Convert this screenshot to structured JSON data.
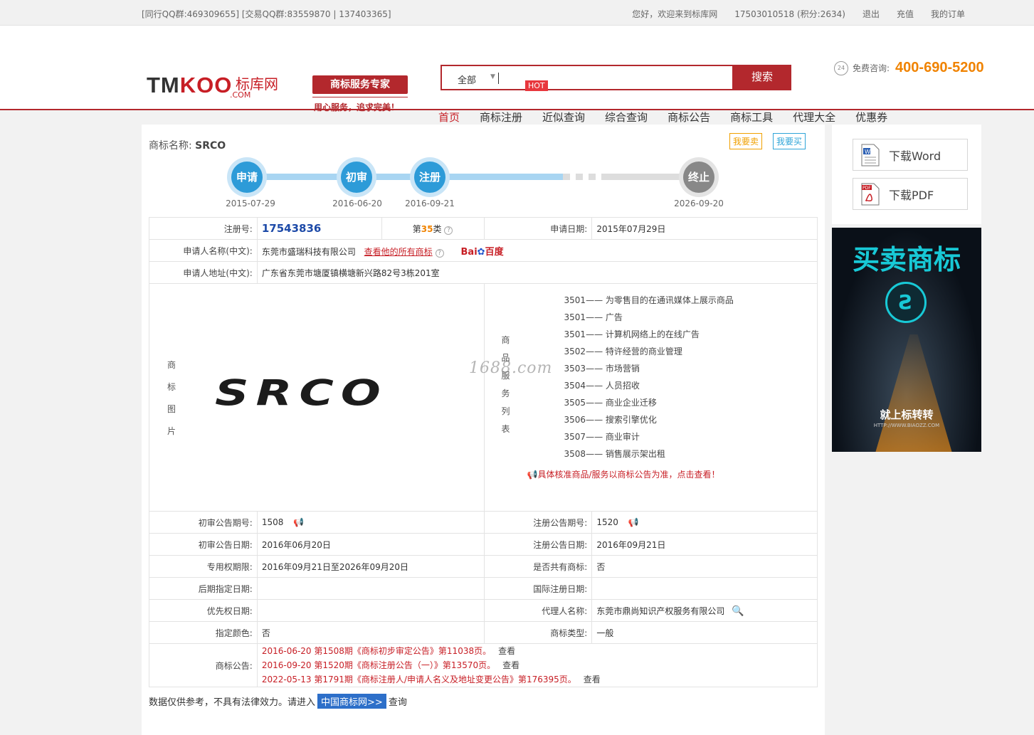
{
  "topbar": {
    "left": "[同行QQ群:469309655] [交易QQ群:83559870 | 137403365]",
    "welcome": "您好，欢迎来到标库网",
    "user": "17503010518 (积分:2634)",
    "logout": "退出",
    "recharge": "充值",
    "orders": "我的订单"
  },
  "logo": {
    "tm": "TM",
    "koo": "KOO",
    "cn": "标库网",
    "com": ".COM"
  },
  "slogan": {
    "title": "商标服务专家",
    "sub": "用心服务，追求完美！"
  },
  "search": {
    "scope": "全部",
    "arrow": "▼",
    "hot": "HOT",
    "button": "搜索",
    "value": ""
  },
  "hotline": {
    "icon_text": "24",
    "label": "免费咨询:",
    "number": "400-690-5200"
  },
  "nav": [
    "首页",
    "商标注册",
    "近似查询",
    "综合查询",
    "商标公告",
    "商标工具",
    "代理大全",
    "优惠券"
  ],
  "trademark": {
    "name_label": "商标名称:",
    "name": "SRCO",
    "sell": "我要卖",
    "buy": "我要买",
    "steps": [
      {
        "label": "申请",
        "date": "2015-07-29"
      },
      {
        "label": "初审",
        "date": "2016-06-20"
      },
      {
        "label": "注册",
        "date": "2016-09-21"
      },
      {
        "label": "终止",
        "date": "2026-09-20"
      }
    ],
    "reg_no_label": "注册号:",
    "reg_no": "17543836",
    "class_prefix": "第",
    "class_no": "35",
    "class_suffix": "类",
    "apply_date_label": "申请日期:",
    "apply_date": "2015年07月29日",
    "applicant_label": "申请人名称(中文):",
    "applicant": "东莞市盛瑞科技有限公司",
    "all_marks_link": "查看他的所有商标",
    "baidu_bai": "Bai",
    "baidu_du": "百度",
    "address_label": "申请人地址(中文):",
    "address": "广东省东莞市塘厦镇横塘新兴路82号3栋201室",
    "image_label": [
      "商",
      "标",
      "图",
      "片"
    ],
    "image_text": "SRCO",
    "services_label": [
      "商",
      "品",
      "服",
      "务",
      "列",
      "表"
    ],
    "services": [
      "3501—— 为零售目的在通讯媒体上展示商品",
      "3501—— 广告",
      "3501—— 计算机网络上的在线广告",
      "3502—— 特许经营的商业管理",
      "3503—— 市场营销",
      "3504—— 人员招收",
      "3505—— 商业企业迁移",
      "3506—— 搜索引擎优化",
      "3507—— 商业审计",
      "3508—— 销售展示架出租"
    ],
    "services_note": "具体核准商品/服务以商标公告为准，点击查看！",
    "prelim_no_label": "初审公告期号:",
    "prelim_no": "1508",
    "reg_pub_no_label": "注册公告期号:",
    "reg_pub_no": "1520",
    "prelim_date_label": "初审公告日期:",
    "prelim_date": "2016年06月20日",
    "reg_pub_date_label": "注册公告日期:",
    "reg_pub_date": "2016年09月21日",
    "exclusive_label": "专用权期限:",
    "exclusive": "2016年09月21日至2026年09月20日",
    "shared_label": "是否共有商标:",
    "shared": "否",
    "later_label": "后期指定日期:",
    "later": "",
    "intl_label": "国际注册日期:",
    "intl": "",
    "priority_label": "优先权日期:",
    "priority": "",
    "agent_label": "代理人名称:",
    "agent": "东莞市鼎尚知识产权服务有限公司",
    "color_label": "指定颜色:",
    "color": "否",
    "type_label": "商标类型:",
    "type": "一般",
    "gazette_label": "商标公告:",
    "gazettes": [
      {
        "text": "2016-06-20 第1508期《商标初步审定公告》第11038页。",
        "view": "查看"
      },
      {
        "text": "2016-09-20 第1520期《商标注册公告（一）》第13570页。",
        "view": "查看"
      },
      {
        "text": "2022-05-13 第1791期《商标注册人/申请人名义及地址变更公告》第176395页。",
        "view": "查看"
      }
    ]
  },
  "footnote": {
    "pre": "数据仅供参考，不具有法律效力。请进入",
    "link": "中国商标网>>",
    "post": "查询"
  },
  "sidebar": {
    "word": "下载Word",
    "pdf": "下载PDF",
    "ad_title": "买卖商标",
    "ad_sub": "就上标转转",
    "ad_url": "HTTP://WWW.BIAOZZ.COM"
  },
  "watermark": "1688.com",
  "colors": {
    "brand_red": "#b3282d",
    "accent_orange": "#f08300",
    "step_blue": "#2d9bd8",
    "link_blue": "#1d4aa8"
  }
}
